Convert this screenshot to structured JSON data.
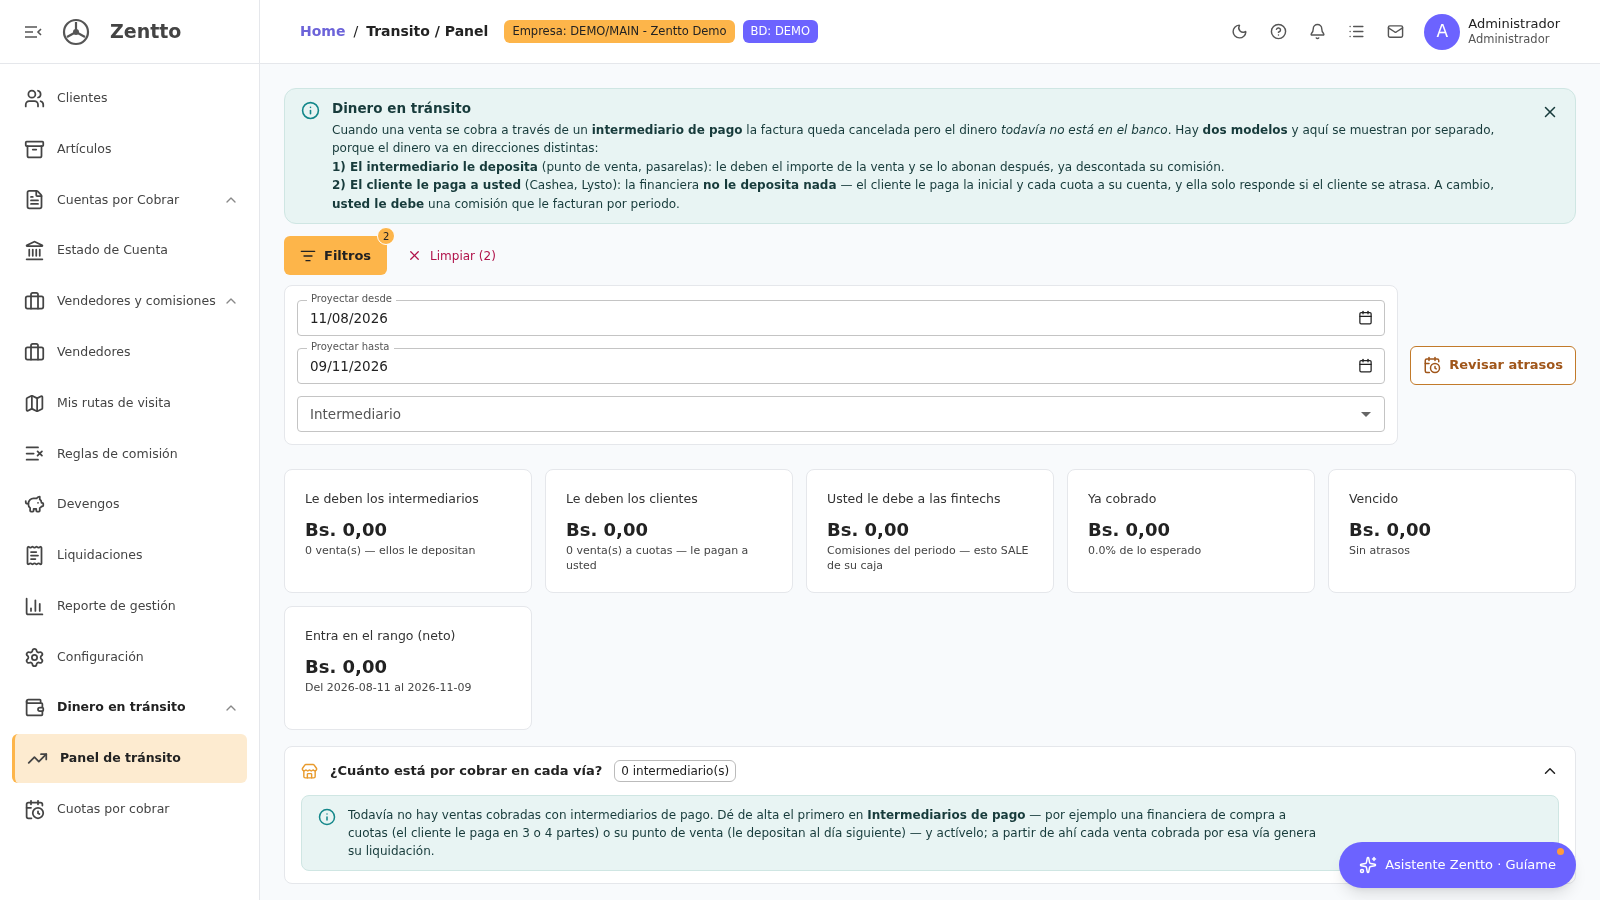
{
  "app": {
    "name": "Zentto"
  },
  "breadcrumb": {
    "home": "Home",
    "separator": "/",
    "current": "Transito / Panel"
  },
  "badges": [
    {
      "text": "Empresa: DEMO/MAIN - Zentto Demo",
      "color": "#fdb54a"
    },
    {
      "text": "BD: DEMO",
      "color": "#6c63ff"
    }
  ],
  "user": {
    "initial": "A",
    "name": "Administrador",
    "role": "Administrador"
  },
  "sidebar": {
    "items": [
      {
        "label": "Clientes",
        "kind": "item",
        "selected": false
      },
      {
        "label": "Artículos",
        "kind": "item",
        "selected": false
      },
      {
        "label": "Cuentas por Cobrar",
        "kind": "group",
        "expanded": true,
        "selected": false
      },
      {
        "label": "Estado de Cuenta",
        "kind": "item",
        "selected": false
      },
      {
        "label": "Vendedores y comisiones",
        "kind": "group",
        "expanded": true,
        "selected": false
      },
      {
        "label": "Vendedores",
        "kind": "item",
        "selected": false
      },
      {
        "label": "Mis rutas de visita",
        "kind": "item",
        "selected": false
      },
      {
        "label": "Reglas de comisión",
        "kind": "item",
        "selected": false
      },
      {
        "label": "Devengos",
        "kind": "item",
        "selected": false
      },
      {
        "label": "Liquidaciones",
        "kind": "item",
        "selected": false
      },
      {
        "label": "Reporte de gestión",
        "kind": "item",
        "selected": false
      },
      {
        "label": "Configuración",
        "kind": "item",
        "selected": false
      },
      {
        "label": "Dinero en tránsito",
        "kind": "group",
        "expanded": true,
        "selected": false
      },
      {
        "label": "Panel de tránsito",
        "kind": "item",
        "selected": true
      },
      {
        "label": "Cuotas por cobrar",
        "kind": "item",
        "selected": false
      }
    ]
  },
  "notice": {
    "title": "Dinero en tránsito",
    "paragraphs": [
      "Cuando una venta se cobra a través de un **intermediario de pago** la factura queda cancelada pero el dinero *todavía no está en el banco*. Hay **dos modelos** y aquí se muestran por separado, porque el dinero va en direcciones distintas:",
      "**1) El intermediario le deposita** (punto de venta, pasarelas): le deben el importe de la venta y se lo abonan después, ya descontada su comisión.",
      "**2) El cliente le paga a usted** (Cashea, Lysto): la financiera **no le deposita nada** — el cliente le paga la inicial y cada cuota a su cuenta, y ella solo responde si el cliente se atrasa. A cambio, **usted le debe** una comisión que le facturan por periodo."
    ]
  },
  "filters": {
    "button": "Filtros",
    "count": "2",
    "clear": "Limpiar (2)",
    "fields": [
      {
        "kind": "date",
        "label": "Proyectar desde",
        "value": "11/08/2026"
      },
      {
        "kind": "date",
        "label": "Proyectar hasta",
        "value": "09/11/2026"
      },
      {
        "kind": "select",
        "placeholder": "Intermediario"
      }
    ],
    "action": "Revisar atrasos"
  },
  "cards": [
    {
      "label": "Le deben los intermediarios",
      "amount": "Bs. 0,00",
      "note": "0 venta(s) — ellos le depositan"
    },
    {
      "label": "Le deben los clientes",
      "amount": "Bs. 0,00",
      "note": "0 venta(s) a cuotas — le pagan a usted"
    },
    {
      "label": "Usted le debe a las fintechs",
      "amount": "Bs. 0,00",
      "note": "Comisiones del periodo — esto SALE de su caja"
    },
    {
      "label": "Ya cobrado",
      "amount": "Bs. 0,00",
      "note": "0.0% de lo esperado"
    },
    {
      "label": "Vencido",
      "amount": "Bs. 0,00",
      "note": "Sin atrasos"
    },
    {
      "label": "Entra en el rango (neto)",
      "amount": "Bs. 0,00",
      "note": "Del 2026-08-11 al 2026-11-09"
    }
  ],
  "section": {
    "title": "¿Cuánto está por cobrar en cada vía?",
    "count": "0 intermediario(s)",
    "expanded": true,
    "message": "Todavía no hay ventas cobradas con intermediarios de pago. Dé de alta el primero en **Intermediarios de pago** — por ejemplo una financiera de compra a cuotas (el cliente le paga en 3 o 4 partes) o su punto de venta (le depositan al día siguiente) — y actívelo; a partir de ahí cada venta cobrada por esa vía genera su liquidación."
  },
  "assistant": {
    "label": "Asistente Zentto · Guíame"
  }
}
